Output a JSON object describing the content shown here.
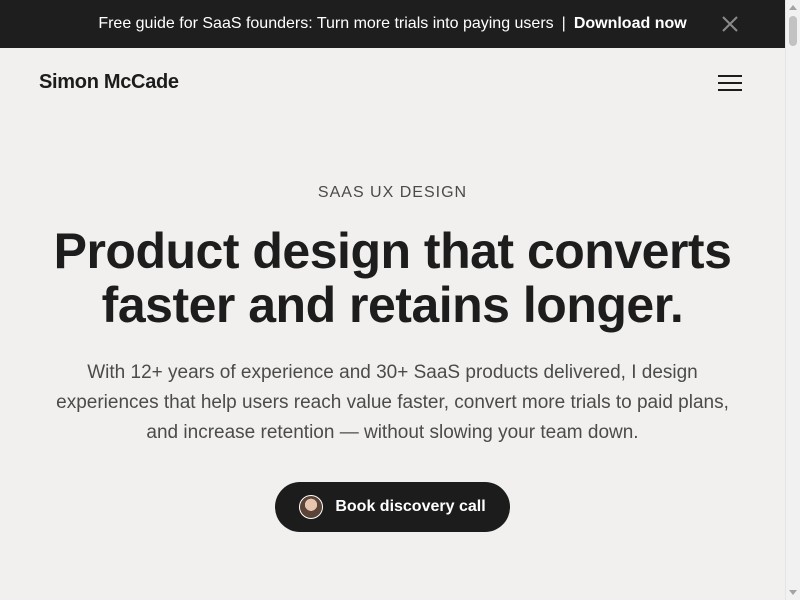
{
  "announcement": {
    "text": "Free guide for SaaS founders: Turn more trials into paying users",
    "separator": "|",
    "link_label": "Download now",
    "close_icon": "close-icon"
  },
  "header": {
    "logo": "Simon McCade",
    "menu_icon": "hamburger-menu-icon"
  },
  "hero": {
    "eyebrow": "SAAS UX DESIGN",
    "headline_line1": "Product design that converts",
    "headline_line2": "faster and retains longer.",
    "subtext": "With 12+ years of experience and 30+ SaaS products delivered, I design experiences that help users reach value faster, convert more trials to paid plans, and increase retention — without slowing your team down.",
    "cta_label": "Book discovery call",
    "cta_icon": "avatar"
  },
  "colors": {
    "background": "#f1f0ef",
    "announcement_bg": "#1e1e1e",
    "text_dark": "#1d1d1d",
    "button_bg": "#1c1c1c"
  }
}
